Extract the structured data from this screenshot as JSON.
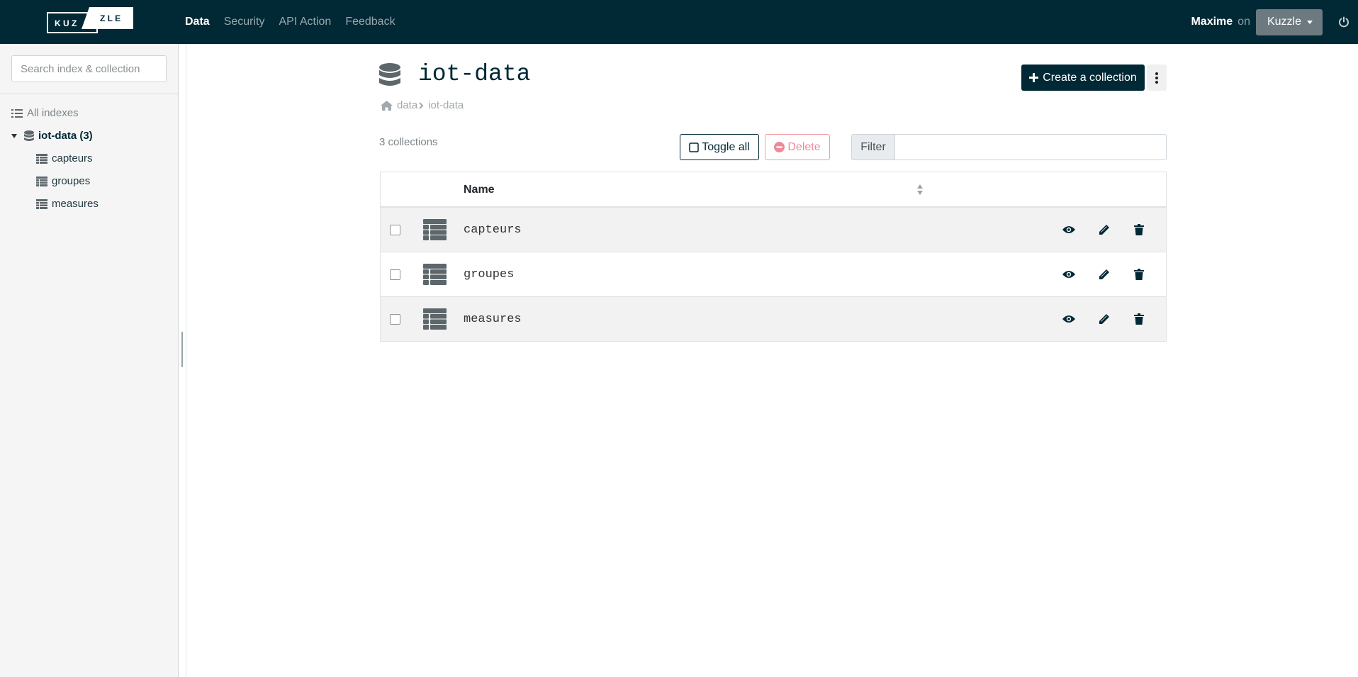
{
  "logo": {
    "letters_left": "K U Z",
    "letters_right": "Z L E"
  },
  "nav": {
    "items": [
      {
        "label": "Data",
        "active": true
      },
      {
        "label": "Security",
        "active": false
      },
      {
        "label": "API Action",
        "active": false
      },
      {
        "label": "Feedback",
        "active": false
      }
    ]
  },
  "user": {
    "name": "Maxime",
    "on_label": "on",
    "environment": "Kuzzle"
  },
  "sidebar": {
    "search_placeholder": "Search index & collection",
    "all_indexes_label": "All indexes",
    "index_label": "iot-data (3)",
    "collections": [
      "capteurs",
      "groupes",
      "measures"
    ]
  },
  "main": {
    "index_title": "iot-data",
    "create_button_label": "Create a collection",
    "breadcrumb": {
      "root": "data",
      "current": "iot-data"
    },
    "collections_count": "3 collections",
    "toggle_all_label": "Toggle all",
    "delete_label": "Delete",
    "filter_label": "Filter",
    "filter_value": ""
  },
  "table": {
    "column_name": "Name",
    "rows": [
      {
        "name": "capteurs"
      },
      {
        "name": "groupes"
      },
      {
        "name": "measures"
      }
    ]
  },
  "colors": {
    "navbar": "#002835",
    "primary": "#002835",
    "danger_outline": "#f19aa4",
    "sidebar_bg": "#f5f5f5"
  }
}
